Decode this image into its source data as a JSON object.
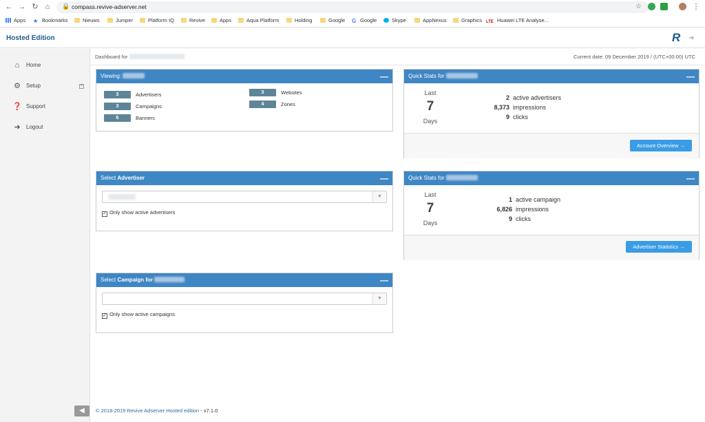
{
  "browser": {
    "url": "compass.revive-adserver.net",
    "bookmarks": [
      {
        "label": "Apps",
        "icon": "apps-grid-icon"
      },
      {
        "label": "Bookmarks",
        "icon": "star-icon"
      },
      {
        "label": "Nieuws",
        "icon": "folder-icon"
      },
      {
        "label": "Jumper",
        "icon": "folder-icon"
      },
      {
        "label": "Platform IQ",
        "icon": "folder-icon"
      },
      {
        "label": "Revive",
        "icon": "folder-icon"
      },
      {
        "label": "Apps",
        "icon": "folder-icon"
      },
      {
        "label": "Aqua Platform",
        "icon": "folder-icon"
      },
      {
        "label": "Holding",
        "icon": "folder-icon"
      },
      {
        "label": "Google",
        "icon": "folder-icon"
      },
      {
        "label": "Google",
        "icon": "google-icon"
      },
      {
        "label": "Skype",
        "icon": "skype-icon"
      },
      {
        "label": "AppNexus",
        "icon": "folder-icon"
      },
      {
        "label": "Graphics",
        "icon": "folder-icon"
      },
      {
        "label": "Huawei LTE Analyse...",
        "icon": "lte-icon"
      }
    ]
  },
  "header": {
    "brand": "Hosted Edition",
    "logo": "R"
  },
  "sidebar": {
    "items": [
      {
        "label": "Home",
        "icon": "home-icon"
      },
      {
        "label": "Setup",
        "icon": "gear-icon"
      },
      {
        "label": "Support",
        "icon": "question-icon"
      },
      {
        "label": "Logout",
        "icon": "logout-icon"
      }
    ]
  },
  "dashboard": {
    "for_label": "Dashboard for",
    "current_date": "Current date: 09 December 2019 / (UTC+00:00) UTC"
  },
  "viewing": {
    "title": "Viewing:",
    "counts": [
      {
        "value": "3",
        "label": "Advertisers"
      },
      {
        "value": "3",
        "label": "Campaigns"
      },
      {
        "value": "6",
        "label": "Banners"
      },
      {
        "value": "3",
        "label": "Websites"
      },
      {
        "value": "4",
        "label": "Zones"
      }
    ]
  },
  "select_advertiser": {
    "title_prefix": "Select",
    "title_bold": "Advertiser",
    "checkbox_label": "Only show active advertisers",
    "checked": true
  },
  "select_campaign": {
    "title_prefix": "Select",
    "title_bold": "Campaign for",
    "checkbox_label": "Only show active campaigns",
    "checked": true
  },
  "quick_stats_1": {
    "title": "Quick Stats for",
    "period": {
      "l1": "Last",
      "l2": "7",
      "l3": "Days"
    },
    "rows": [
      {
        "num": "2",
        "label": "active advertisers"
      },
      {
        "num": "8,373",
        "label": "impressions"
      },
      {
        "num": "9",
        "label": "clicks"
      }
    ],
    "button": "Account Overview →"
  },
  "quick_stats_2": {
    "title": "Quick Stats for",
    "period": {
      "l1": "Last",
      "l2": "7",
      "l3": "Days"
    },
    "rows": [
      {
        "num": "1",
        "label": "active campaign"
      },
      {
        "num": "6,826",
        "label": "impressions"
      },
      {
        "num": "9",
        "label": "clicks"
      }
    ],
    "button": "Advertiser Statistics →"
  },
  "footer": {
    "copyright": "© 2018-2019 Revive Adserver Hosted edition",
    "version": "- v7.1.0"
  },
  "colors": {
    "panel_header": "#3f86c5",
    "count_badge": "#5e8597",
    "button": "#3a9ce5",
    "brand": "#1f5d8e"
  }
}
